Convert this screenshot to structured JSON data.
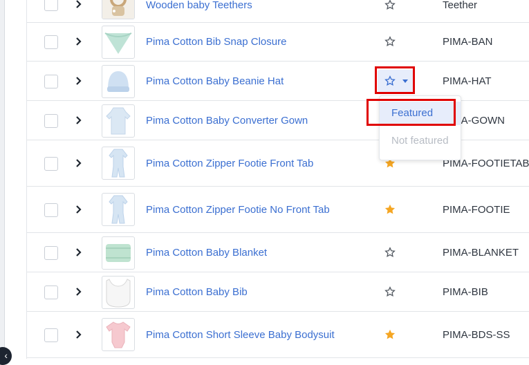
{
  "colors": {
    "link": "#3b6fd1",
    "star_filled": "#f5a623",
    "star_outline": "#555b63",
    "highlight": "#e00000"
  },
  "products": [
    {
      "name": "Wooden baby Teethers",
      "sku": "Teether",
      "featured": false,
      "thumb": "teether"
    },
    {
      "name": "Pima Cotton Bib Snap Closure",
      "sku": "PIMA-BAN",
      "featured": false,
      "thumb": "bandana-bib"
    },
    {
      "name": "Pima Cotton Baby Beanie Hat",
      "sku": "PIMA-HAT",
      "featured": false,
      "thumb": "beanie"
    },
    {
      "name": "Pima Cotton Baby Converter Gown",
      "sku": "PIMA-GOWN",
      "featured": false,
      "thumb": "gown"
    },
    {
      "name": "Pima Cotton Zipper Footie Front Tab",
      "sku": "PIMA-FOOTIETAB",
      "featured": true,
      "thumb": "footie"
    },
    {
      "name": "Pima Cotton Zipper Footie No Front Tab",
      "sku": "PIMA-FOOTIE",
      "featured": true,
      "thumb": "footie"
    },
    {
      "name": "Pima Cotton Baby Blanket",
      "sku": "PIMA-BLANKET",
      "featured": false,
      "thumb": "blanket"
    },
    {
      "name": "Pima Cotton Baby Bib",
      "sku": "PIMA-BIB",
      "featured": false,
      "thumb": "bib"
    },
    {
      "name": "Pima Cotton Short Sleeve Baby Bodysuit",
      "sku": "PIMA-BDS-SS",
      "featured": true,
      "thumb": "bodysuit"
    }
  ],
  "featured_menu": {
    "options": [
      "Featured",
      "Not featured"
    ],
    "selected": "Featured"
  },
  "sidebar": {
    "collapse_icon": "chevron-left-icon"
  }
}
